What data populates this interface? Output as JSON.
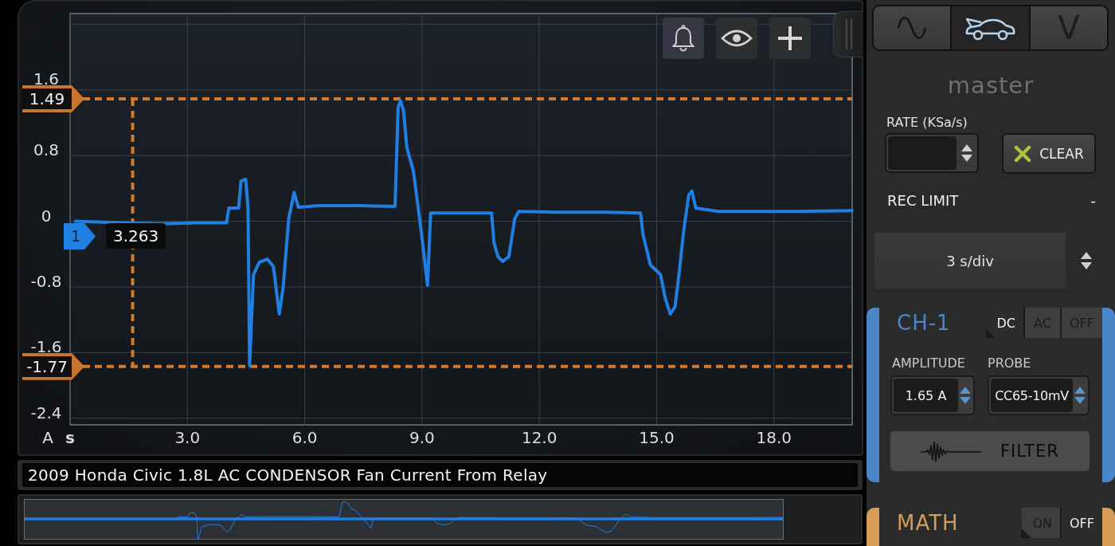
{
  "chart_panel": {
    "toolbar": [
      {
        "kind": "alert",
        "on": true
      },
      {
        "kind": "visibility",
        "on": false
      },
      {
        "kind": "add",
        "on": false
      }
    ],
    "chart_data": {
      "type": "line",
      "xlabel": "s",
      "ylabel": "A",
      "x": [
        0.14,
        1.27,
        2.29,
        3.31,
        4.0,
        4.06,
        4.31,
        4.37,
        4.49,
        4.55,
        4.59,
        4.69,
        4.84,
        5.04,
        5.2,
        5.35,
        5.45,
        5.59,
        5.73,
        5.84,
        6.37,
        7.39,
        8.31,
        8.39,
        8.45,
        8.53,
        8.61,
        8.78,
        8.98,
        9.14,
        9.22,
        10.04,
        10.78,
        10.84,
        10.94,
        11.06,
        11.22,
        11.37,
        11.47,
        12.49,
        13.71,
        14.59,
        14.65,
        14.84,
        15.1,
        15.22,
        15.35,
        15.47,
        15.57,
        15.69,
        15.82,
        15.9,
        16.0,
        16.57,
        17.59,
        18.61,
        20.0
      ],
      "series": [
        {
          "color": "#1f7fe3",
          "values": [
            0.0,
            -0.02,
            -0.03,
            -0.02,
            -0.02,
            0.16,
            0.16,
            0.49,
            0.51,
            0.17,
            -1.76,
            -0.65,
            -0.5,
            -0.46,
            -0.55,
            -1.13,
            -0.8,
            0.03,
            0.35,
            0.17,
            0.19,
            0.19,
            0.18,
            1.39,
            1.47,
            1.34,
            0.9,
            0.61,
            -0.12,
            -0.78,
            0.1,
            0.1,
            0.1,
            -0.26,
            -0.43,
            -0.49,
            -0.43,
            0.03,
            0.12,
            0.11,
            0.11,
            0.1,
            -0.16,
            -0.53,
            -0.65,
            -0.94,
            -1.13,
            -1.04,
            -0.65,
            -0.12,
            0.32,
            0.37,
            0.16,
            0.12,
            0.12,
            0.12,
            0.13
          ]
        }
      ],
      "xlim": [
        0,
        20
      ],
      "ylim": [
        -2.48,
        2.53
      ],
      "xticks": [
        {
          "value": 3,
          "label": "3.0"
        },
        {
          "value": 6,
          "label": "6.0"
        },
        {
          "value": 9,
          "label": "9.0"
        },
        {
          "value": 12,
          "label": "12.0"
        },
        {
          "value": 15,
          "label": "15.0"
        },
        {
          "value": 18,
          "label": "18.0"
        }
      ],
      "yticks": [
        1.6,
        0.8,
        0,
        -0.8,
        -1.6,
        -2.4
      ],
      "grid": true,
      "ref_lines": [
        {
          "axis": "y",
          "value": 1.49,
          "label": "1.49"
        },
        {
          "axis": "y",
          "value": -1.77,
          "label": "-1.77"
        },
        {
          "axis": "x",
          "value": 1.6
        }
      ]
    },
    "channel_marker": "1",
    "readout": "3.263"
  },
  "title_field": "2009 Honda Civic 1.8L AC CONDENSOR Fan Current From Relay",
  "sidebar": {
    "tabs": [
      {
        "kind": "scope",
        "selected": false
      },
      {
        "kind": "vehicle",
        "selected": true
      },
      {
        "kind": "meter",
        "label": "V",
        "selected": false
      }
    ],
    "title": "master",
    "rate": {
      "label": "RATE (KSa/s)"
    },
    "clear_button": "CLEAR",
    "rec_limit": {
      "label": "REC LIMIT",
      "value": "-"
    },
    "timebase": "3 s/div",
    "cards": [
      {
        "kind": "channel",
        "title": "CH-1",
        "color": "#4a86c8",
        "coupling": [
          {
            "label": "DC",
            "selected": true
          },
          {
            "label": "AC",
            "selected": false
          },
          {
            "label": "OFF",
            "selected": false
          }
        ],
        "amplitude": {
          "label": "AMPLITUDE",
          "value": "1.65 A"
        },
        "probe": {
          "label": "PROBE",
          "value": "CC65-10mV"
        },
        "filter_button": "FILTER"
      },
      {
        "kind": "math",
        "title": "MATH",
        "color": "#d69b55",
        "modes": [
          {
            "label": "ON",
            "selected": false
          },
          {
            "label": "OFF",
            "selected": true
          }
        ]
      }
    ]
  }
}
